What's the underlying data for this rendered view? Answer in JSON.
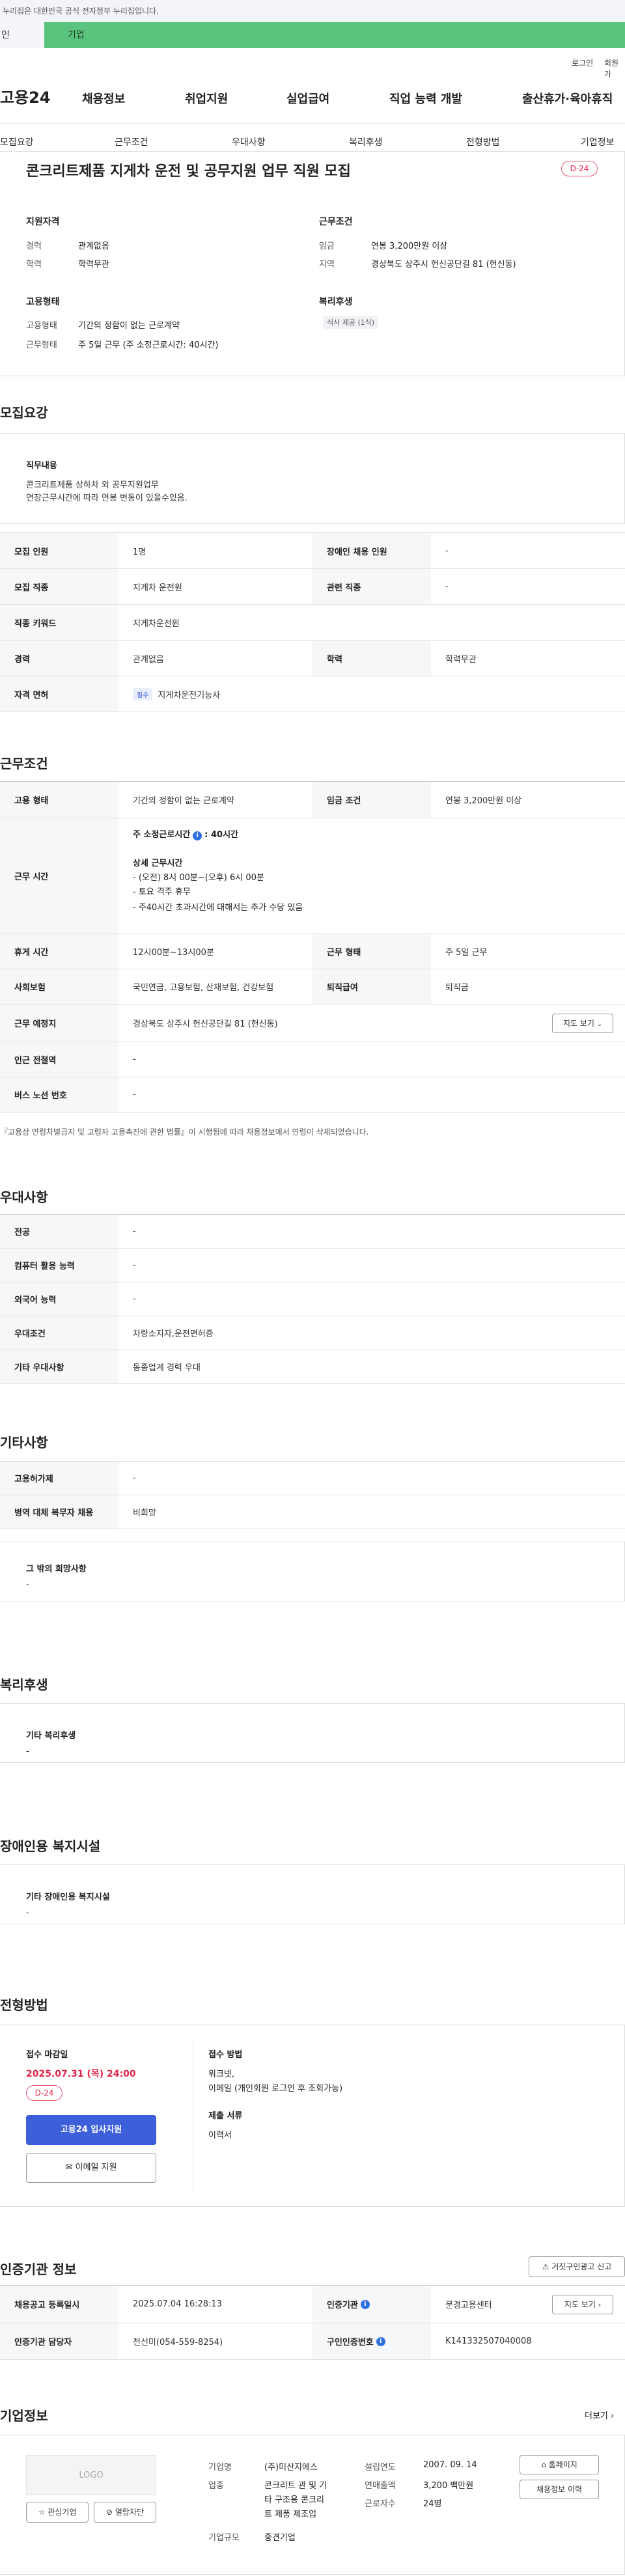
{
  "top_notice": "누리집은 대한민국 공식 전자정부 누리집입니다.",
  "tabs": [
    "인",
    "기업"
  ],
  "util": {
    "login": "로그인",
    "join": "회원가"
  },
  "gnb": {
    "logo": "고용24",
    "menus": [
      "채용정보",
      "취업지원",
      "실업급여",
      "직업 능력 개발",
      "출산휴가·육아휴직"
    ]
  },
  "snb": [
    "모집요강",
    "근무조건",
    "우대사항",
    "복리후생",
    "전형방법",
    "기업정보"
  ],
  "summary": {
    "title": "콘크리트제품 지게차 운전 및 공무지원 업무 직원 모집",
    "dday": "D-24",
    "qual_head": "지원자격",
    "career_label": "경력",
    "career": "관계없음",
    "edu_label": "학력",
    "edu": "학력무관",
    "cond_head": "근무조건",
    "wage_label": "임금",
    "wage": "연봉 3,200만원 이상",
    "area_label": "지역",
    "area": "경상북도 상주시 헌신공단길 81 (헌신동)",
    "emp_head": "고용형태",
    "emp_label": "고용형태",
    "emp": "기간의 정함이 없는 근로계약",
    "work_label": "근무형태",
    "work": "주 5일 근무 (주 소정근로시간: 40시간)",
    "welfare_head": "복리후생",
    "welfare_chip": "식사 제공 (1식)"
  },
  "recruit": {
    "heading": "모집요강",
    "duty_head": "직무내용",
    "duty_line1": "콘크리트제품 상하차 외 공무지원업무",
    "duty_line2": "연장근무시간에 따라 연봉 변동이 있을수있음.",
    "rows": {
      "count_label": "모집 인원",
      "count": "1명",
      "disabled_label": "장애인 채용 인원",
      "disabled": "-",
      "job_label": "모집 직종",
      "job": "지게차 운전원",
      "related_label": "관련 직종",
      "related": "-",
      "keyword_label": "직종 키워드",
      "keyword": "지게차운전원",
      "career_label": "경력",
      "career": "관계없음",
      "edu_label": "학력",
      "edu": "학력무관",
      "license_label": "자격 면허",
      "license_tag": "필수",
      "license": "지게차운전기능사"
    }
  },
  "conditions": {
    "heading": "근무조건",
    "emp_label": "고용 형태",
    "emp": "기간의 정함이 없는 근로계약",
    "wage_label": "임금 조건",
    "wage": "연봉 3,200만원 이상",
    "hours_label": "근무 시간",
    "hours_main": "주 소정근로시간",
    "hours_main_val": ": 40시간",
    "hours_detail_head": "상세 근무시간",
    "hours_detail": [
      "- (오전) 8시 00분~(오후) 6시 00분",
      "- 토요 격주 휴무",
      "- 주40시간 초과시간에 대해서는 추가 수당 있음"
    ],
    "break_label": "휴게 시간",
    "break": "12시00분~13시00분",
    "form_label": "근무 형태",
    "form": "주 5일 근무",
    "insurance_label": "사회보험",
    "insurance": "국민연금, 고용보험, 산재보험, 건강보험",
    "retire_label": "퇴직급여",
    "retire": "퇴직금",
    "place_label": "근무 예정지",
    "place": "경상북도 상주시 헌신공단길 81 (헌신동)",
    "map_btn": "지도 보기",
    "subway_label": "인근 전철역",
    "subway": "-",
    "bus_label": "버스 노선 번호",
    "bus": "-",
    "note": "『고용상 연령차별금지 및 고령자 고용촉진에 관한 법률』이 시행됨에 따라 채용정보에서 연령이 삭제되었습니다."
  },
  "prefer": {
    "heading": "우대사항",
    "major_label": "전공",
    "major": "-",
    "pc_label": "컴퓨터 활용 능력",
    "pc": "-",
    "lang_label": "외국어 능력",
    "lang": "-",
    "cond_label": "우대조건",
    "cond": "차량소지자,운전면허증",
    "etc_label": "기타 우대사항",
    "etc": "동종업계 경력 우대"
  },
  "etc": {
    "heading": "기타사항",
    "disabled_label": "고용허가제",
    "disabled": "-",
    "military_label": "병역 대체 복무자 채용",
    "military": "비희망",
    "wish_head": "그 밖의 희망사항",
    "wish": "-"
  },
  "welfare": {
    "heading": "복리후생",
    "box_head": "기타 복리후생",
    "box_val": "-"
  },
  "facility": {
    "heading": "장애인용 복지시설",
    "box_head": "기타 장애인용 복지시설",
    "box_val": "-"
  },
  "process": {
    "heading": "전형방법",
    "deadline_head": "접수 마감일",
    "deadline": "2025.07.31 (목) 24:00",
    "dday": "D-24",
    "apply_btn": "고용24 입사지원",
    "email_btn": "이메일 지원",
    "method_head": "접수 방법",
    "method_line1": "워크넷,",
    "method_line2": "이메일 (개인회원 로그인 후 조회가능)",
    "docs_head": "제출 서류",
    "docs": "이력서"
  },
  "agency": {
    "heading": "인증기관 정보",
    "report_btn": "거짓구인광고 신고",
    "reg_label": "채용공고 등록일시",
    "reg": "2025.07.04 16:28:13",
    "org_label": "인증기관",
    "org": "문경고용센터",
    "map_btn": "지도 보기",
    "staff_label": "인증기관 담당자",
    "staff": "천선미(054-559-8254)",
    "no_label": "구인인증번호",
    "no": "K141332507040008"
  },
  "company": {
    "heading": "기업정보",
    "more": "더보기",
    "logo": "LOGO",
    "fav_btn": "관심기업",
    "block_btn": "열람차단",
    "name_label": "기업명",
    "name": "(주)미산지에스",
    "biz_label": "업종",
    "biz": [
      "콘크리트 관 및 기",
      "타 구조용 콘크리",
      "트 제품 제조업"
    ],
    "size_label": "기업규모",
    "size": "중견기업",
    "year_label": "설립연도",
    "year": "2007. 09. 14",
    "sales_label": "연매출액",
    "sales": "3,200 백만원",
    "staff_label": "근로자수",
    "staff": "24명",
    "home_btn": "홈페이지",
    "history_btn": "채용정보 이력"
  },
  "colors": {
    "accent": "#5ac47e",
    "primary": "#3d5fd9",
    "dday": "#e0254a"
  }
}
